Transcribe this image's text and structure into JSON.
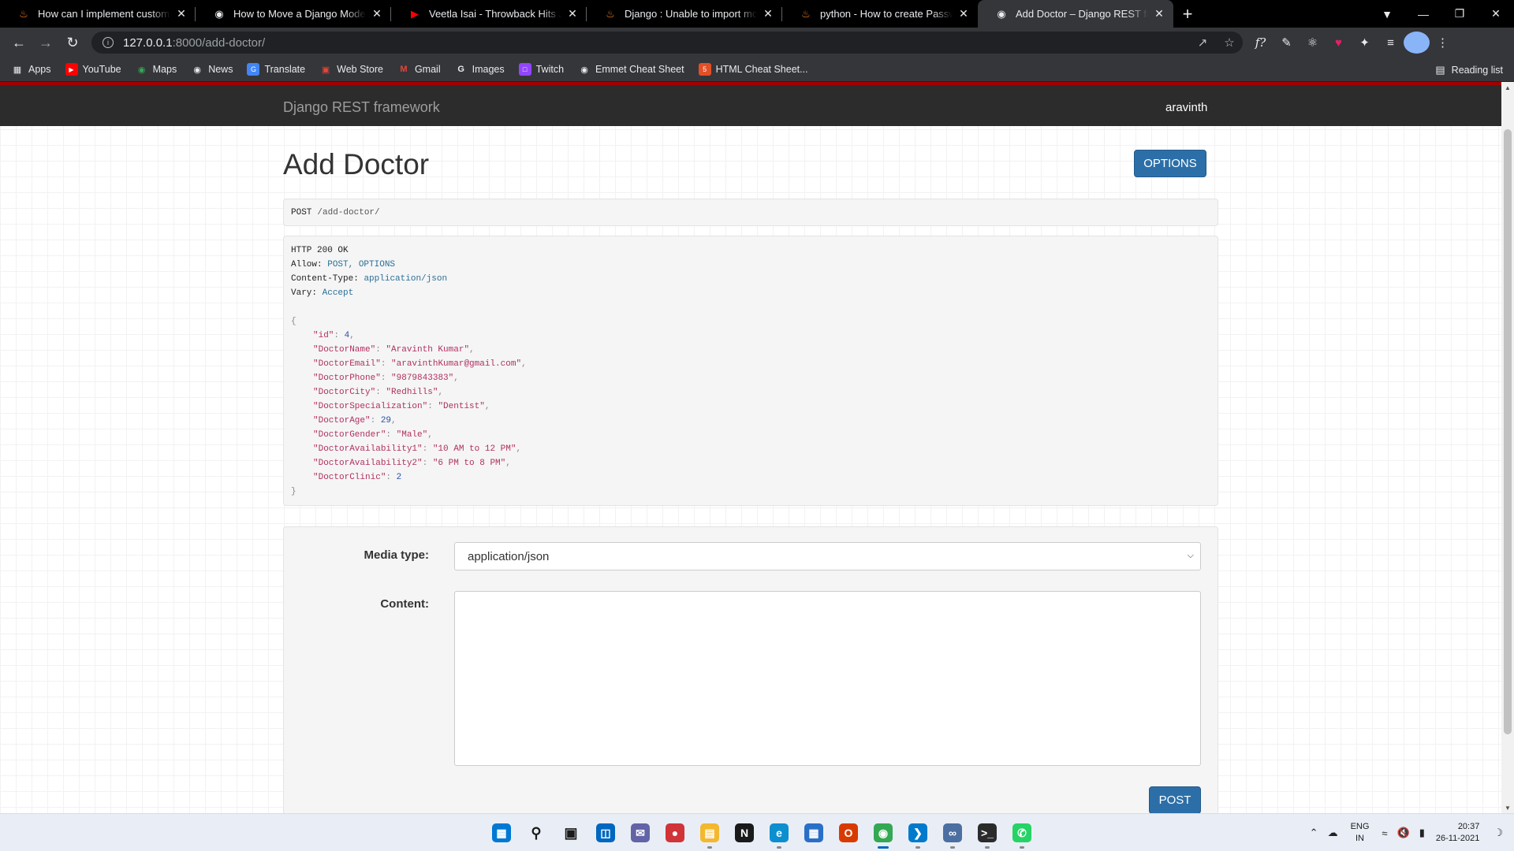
{
  "browser": {
    "tabs": [
      {
        "title": "How can I implement custom user",
        "favicon": "django-flame-icon",
        "color": "#f48024"
      },
      {
        "title": "How to Move a Django Model to",
        "favicon": "globe-icon",
        "color": "#e8eaed"
      },
      {
        "title": "Veetla Isai - Throwback Hits Jukebox",
        "favicon": "youtube-icon",
        "color": "#ff0000"
      },
      {
        "title": "Django : Unable to import models",
        "favicon": "django-flame-icon",
        "color": "#f48024"
      },
      {
        "title": "python - How to create Password",
        "favicon": "django-flame-icon",
        "color": "#f48024"
      },
      {
        "title": "Add Doctor – Django REST framework",
        "favicon": "globe-icon",
        "color": "#e8eaed"
      }
    ],
    "new_tab": "+",
    "address": {
      "host": "127.0.0.1",
      "path": ":8000/add-doctor/"
    },
    "bookmarks": [
      {
        "label": "Apps",
        "icon": "apps-grid-icon",
        "color": "#e8eaed"
      },
      {
        "label": "YouTube",
        "icon": "youtube-icon",
        "color": "#ff0000"
      },
      {
        "label": "Maps",
        "icon": "maps-pin-icon",
        "color": "#34a853"
      },
      {
        "label": "News",
        "icon": "globe-icon",
        "color": "#e8eaed"
      },
      {
        "label": "Translate",
        "icon": "translate-icon",
        "color": "#4285f4"
      },
      {
        "label": "Web Store",
        "icon": "webstore-icon",
        "color": "#ea4335"
      },
      {
        "label": "Gmail",
        "icon": "gmail-icon",
        "color": "#ea4335"
      },
      {
        "label": "Images",
        "icon": "google-icon",
        "color": "#e8eaed"
      },
      {
        "label": "Twitch",
        "icon": "twitch-icon",
        "color": "#9146ff"
      },
      {
        "label": "Emmet Cheat Sheet",
        "icon": "globe-icon",
        "color": "#e8eaed"
      },
      {
        "label": "HTML Cheat Sheet...",
        "icon": "html5-icon",
        "color": "#e34f26"
      }
    ],
    "reading_list": "Reading list"
  },
  "site": {
    "brand": "Django REST framework",
    "user": "aravinth",
    "accent": "#a30000"
  },
  "page": {
    "title": "Add Doctor",
    "options_label": "OPTIONS",
    "request": {
      "method": "POST",
      "url": "/add-doctor/"
    },
    "response": {
      "status": "HTTP 200 OK",
      "headers": [
        {
          "key": "Allow:",
          "value": "POST, OPTIONS"
        },
        {
          "key": "Content-Type:",
          "value": "application/json"
        },
        {
          "key": "Vary:",
          "value": "Accept"
        }
      ],
      "open_brace": "{",
      "close_brace": "}",
      "fields": [
        {
          "key": "\"id\"",
          "value": "4",
          "type": "number"
        },
        {
          "key": "\"DoctorName\"",
          "value": "\"Aravinth Kumar\"",
          "type": "string"
        },
        {
          "key": "\"DoctorEmail\"",
          "value": "\"aravinthKumar@gmail.com\"",
          "type": "string"
        },
        {
          "key": "\"DoctorPhone\"",
          "value": "\"9879843383\"",
          "type": "string"
        },
        {
          "key": "\"DoctorCity\"",
          "value": "\"Redhills\"",
          "type": "string"
        },
        {
          "key": "\"DoctorSpecialization\"",
          "value": "\"Dentist\"",
          "type": "string"
        },
        {
          "key": "\"DoctorAge\"",
          "value": "29",
          "type": "number"
        },
        {
          "key": "\"DoctorGender\"",
          "value": "\"Male\"",
          "type": "string"
        },
        {
          "key": "\"DoctorAvailability1\"",
          "value": "\"10 AM to 12 PM\"",
          "type": "string"
        },
        {
          "key": "\"DoctorAvailability2\"",
          "value": "\"6 PM to 8 PM\"",
          "type": "string"
        },
        {
          "key": "\"DoctorClinic\"",
          "value": "2",
          "type": "number"
        }
      ]
    },
    "form": {
      "media_type_label": "Media type:",
      "media_type_value": "application/json",
      "content_label": "Content:",
      "content_value": "",
      "post_label": "POST"
    }
  },
  "taskbar": {
    "apps": [
      {
        "name": "windows-start-icon",
        "color": "#0078d4"
      },
      {
        "name": "search-icon",
        "color": "#1a1a1a"
      },
      {
        "name": "task-view-icon",
        "color": "#1a1a1a"
      },
      {
        "name": "widgets-icon",
        "color": "#0067c0"
      },
      {
        "name": "teams-chat-icon",
        "color": "#6264a7"
      },
      {
        "name": "record-icon",
        "color": "#d13438"
      },
      {
        "name": "file-explorer-icon",
        "color": "#f3b82f"
      },
      {
        "name": "notion-icon",
        "color": "#1a1a1a"
      },
      {
        "name": "edge-icon",
        "color": "#0c8fcf"
      },
      {
        "name": "store-icon",
        "color": "#2a6fc7"
      },
      {
        "name": "office-icon",
        "color": "#d83b01"
      },
      {
        "name": "chrome-icon",
        "color": "#34a853"
      },
      {
        "name": "vscode-icon",
        "color": "#007acc"
      },
      {
        "name": "vs-icon",
        "color": "#4b6fa1"
      },
      {
        "name": "terminal-icon",
        "color": "#2b2b2b"
      },
      {
        "name": "whatsapp-icon",
        "color": "#25d366"
      }
    ],
    "lang_top": "ENG",
    "lang_bottom": "IN",
    "time": "20:37",
    "date": "26-11-2021"
  }
}
